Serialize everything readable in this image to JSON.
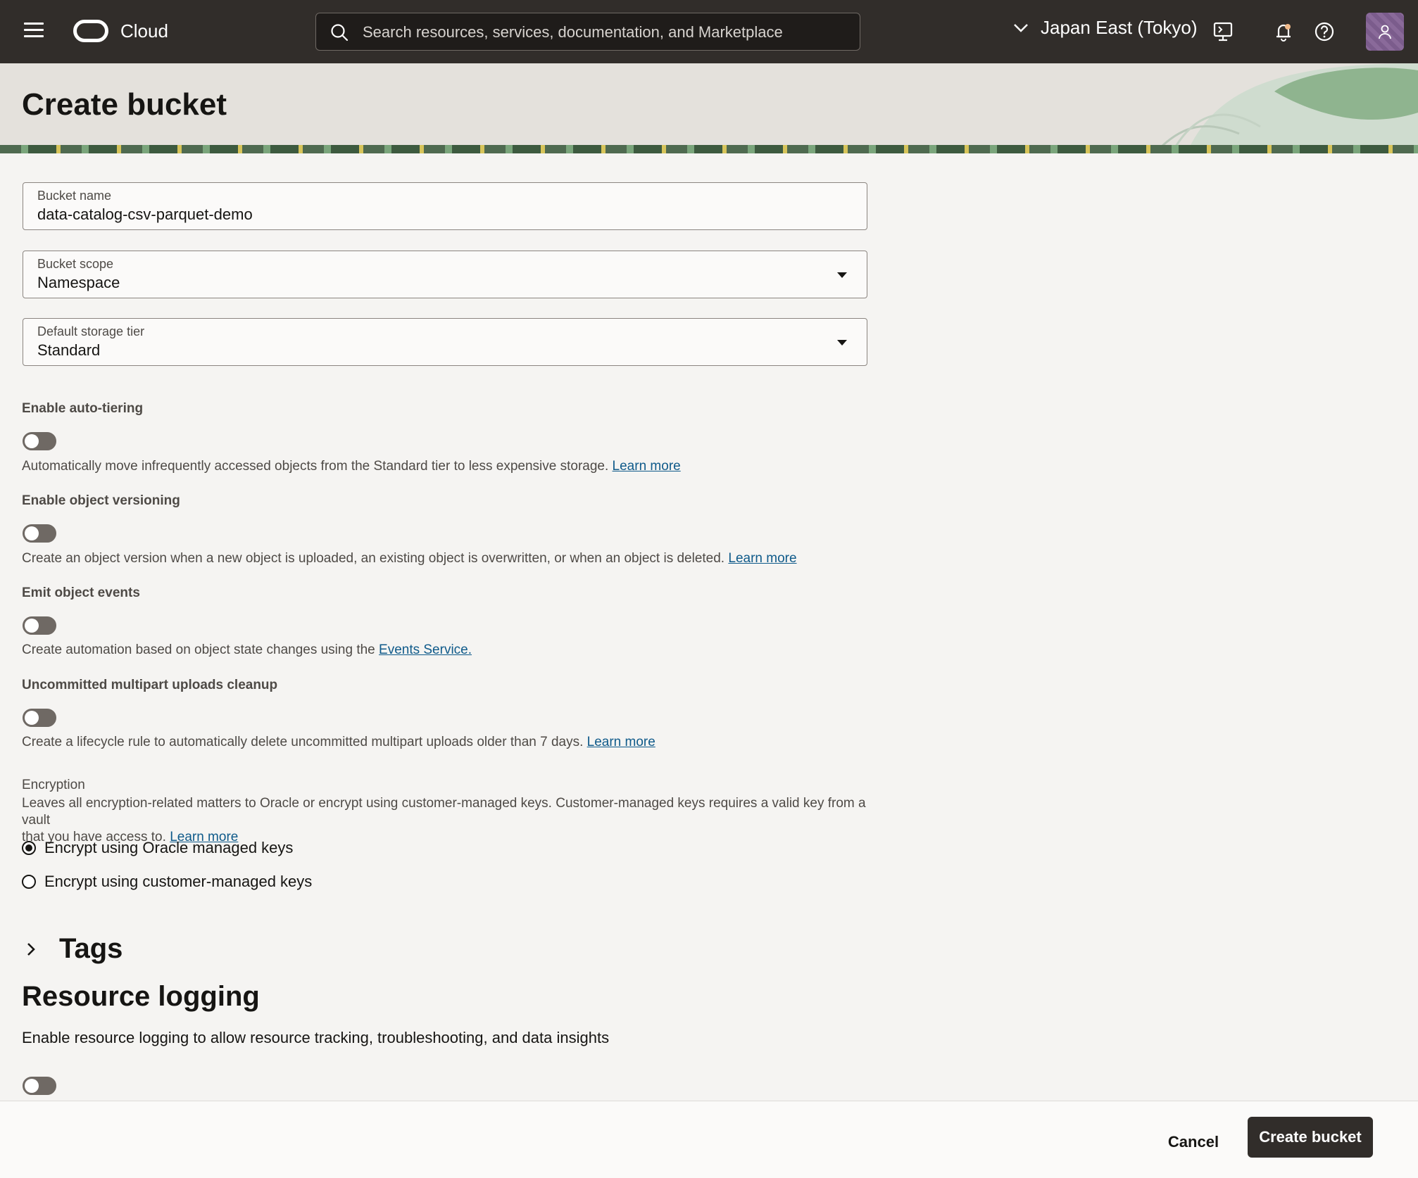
{
  "topbar": {
    "menu_icon": "hamburger-menu-icon",
    "brand": "Cloud",
    "search_placeholder": "Search resources, services, documentation, and Marketplace",
    "region": "Japan East (Tokyo)",
    "icons": [
      "chevron-down-icon",
      "cloud-shell-icon",
      "bell-icon",
      "help-icon",
      "user-icon"
    ]
  },
  "page": {
    "title": "Create bucket"
  },
  "form": {
    "bucket_name": {
      "label": "Bucket name",
      "value": "data-catalog-csv-parquet-demo"
    },
    "bucket_scope": {
      "label": "Bucket scope",
      "value": "Namespace"
    },
    "storage_tier": {
      "label": "Default storage tier",
      "value": "Standard"
    },
    "auto_tiering": {
      "label": "Enable auto-tiering",
      "enabled": false,
      "help": "Automatically move infrequently accessed objects from the Standard tier to less expensive storage.",
      "link": "Learn more"
    },
    "versioning": {
      "label": "Enable object versioning",
      "enabled": false,
      "help": "Create an object version when a new object is uploaded, an existing object is overwritten, or when an object is deleted.",
      "link": "Learn more"
    },
    "events": {
      "label": "Emit object events",
      "enabled": false,
      "help": "Create automation based on object state changes using the",
      "link": "Events Service."
    },
    "multipart": {
      "label": "Uncommitted multipart uploads cleanup",
      "enabled": false,
      "help": "Create a lifecycle rule to automatically delete uncommitted multipart uploads older than 7 days.",
      "link": "Learn more"
    },
    "encryption": {
      "label": "Encryption",
      "help_line1": "Leaves all encryption-related matters to Oracle or encrypt using customer-managed keys. Customer-managed keys requires a valid key from a vault",
      "help_line2": "that you have access to.",
      "link": "Learn more",
      "options": [
        {
          "label": "Encrypt using Oracle managed keys",
          "checked": true
        },
        {
          "label": "Encrypt using customer-managed keys",
          "checked": false
        }
      ]
    },
    "tags": {
      "title": "Tags"
    },
    "resource_logging": {
      "title": "Resource logging",
      "desc": "Enable resource logging to allow resource tracking, troubleshooting, and data insights",
      "enabled": false
    }
  },
  "footer": {
    "cancel": "Cancel",
    "create": "Create bucket"
  }
}
